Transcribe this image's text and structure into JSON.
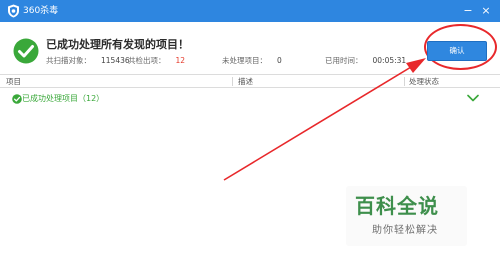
{
  "window": {
    "title": "360杀毒",
    "minimize_glyph": "−",
    "close_glyph": "×"
  },
  "result": {
    "title": "已成功处理所有发现的项目！",
    "stats": [
      {
        "label": "共扫描对象：",
        "value": "115436",
        "highlight": false
      },
      {
        "label": "共检出项：",
        "value": "12",
        "highlight": true
      },
      {
        "label": "未处理项目：",
        "value": "0",
        "highlight": false
      },
      {
        "label": "已用时间：",
        "value": "00:05:31",
        "highlight": false
      }
    ]
  },
  "actions": {
    "confirm_label": "确认"
  },
  "table": {
    "columns": [
      "项目",
      "描述",
      "处理状态"
    ],
    "groups": [
      {
        "label": "已成功处理项目（12）",
        "icon": "green-check-icon",
        "expanded": false
      }
    ]
  },
  "watermark": {
    "title": "百科全说",
    "subtitle": "助你轻松解决"
  },
  "colors": {
    "titlebar": "#2e86e0",
    "success": "#3aa83a",
    "highlight_red": "#e53b2c",
    "annotation_red": "#e8282b"
  }
}
